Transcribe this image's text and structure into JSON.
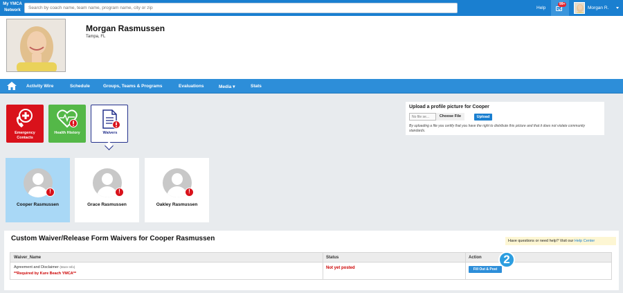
{
  "topbar": {
    "brand": "My YMCA Network",
    "search_placeholder": "Search by coach name, team name, program name, city or zip",
    "help": "Help",
    "notif_badge": "99+",
    "user_name": "Morgan R."
  },
  "profile": {
    "name": "Morgan Rasmussen",
    "location": "Tampa, FL"
  },
  "nav": {
    "items": [
      "Activity Wire",
      "Schedule",
      "Groups, Teams & Programs",
      "Evaluations",
      "Media ▾",
      "Stats"
    ]
  },
  "tiles": {
    "emergency": "Emergency Contacts",
    "health": "Health History",
    "waivers": "Waivers"
  },
  "upload": {
    "title": "Upload a profile picture for Cooper",
    "no_file": "No file se...",
    "choose_file": "Choose File",
    "upload_button": "Upload",
    "note": "By uploading a file you certify that you have the right to distribute this picture and that it does not violate community standards."
  },
  "people": [
    {
      "name": "Cooper Rasmussen",
      "selected": true
    },
    {
      "name": "Grace Rasmussen",
      "selected": false
    },
    {
      "name": "Oakley Rasmussen",
      "selected": false
    }
  ],
  "waivers": {
    "title": "Custom Waiver/Release Form Waivers for Cooper Rasmussen",
    "help_text": "Have questions or need help? Visit our ",
    "help_link": "Help Center",
    "columns": [
      "Waiver_Name",
      "Status",
      "Action"
    ],
    "rows": [
      {
        "name": "Agreement and Disclaimer",
        "more": "(More Info)",
        "required": "**Required by Kure Beach YMCA**",
        "status": "Not yet posted",
        "action": "Fill Out & Post"
      }
    ]
  },
  "step_marker": "2",
  "colors": {
    "topbar": "#1a7fd0",
    "nav": "#2d8ed9",
    "emergency": "#d9121b",
    "health": "#54b848",
    "waivers_border": "#23308c",
    "selected_card": "#a9d8f6",
    "status_red": "#cc0000"
  }
}
